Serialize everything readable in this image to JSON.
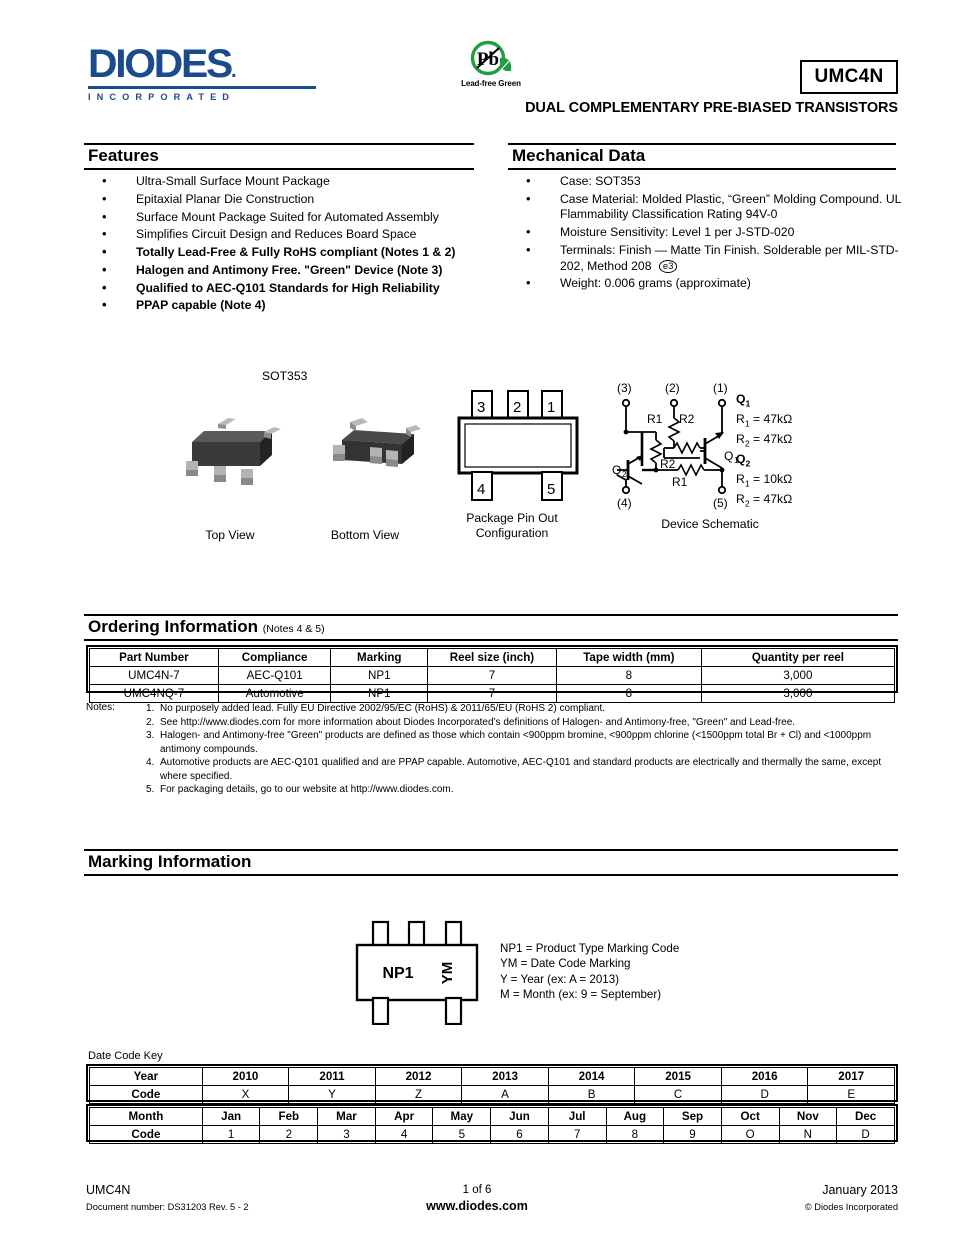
{
  "header": {
    "logo_main": "DIODES",
    "logo_sub": "INCORPORATED",
    "pb_symbol": "Pb",
    "pb_caption": "Lead-free Green",
    "part_number": "UMC4N",
    "subtitle": "DUAL COMPLEMENTARY PRE-BIASED TRANSISTORS"
  },
  "features": {
    "title": "Features",
    "items": [
      {
        "text": "Ultra-Small Surface Mount Package",
        "bold": false
      },
      {
        "text": "Epitaxial Planar Die Construction",
        "bold": false
      },
      {
        "text": "Surface Mount Package Suited for Automated Assembly",
        "bold": false
      },
      {
        "text": "Simplifies Circuit Design and Reduces Board Space",
        "bold": false
      },
      {
        "text": "Totally Lead-Free & Fully RoHS compliant (Notes 1 & 2)",
        "bold": true
      },
      {
        "text": "Halogen and Antimony Free. \"Green\" Device (Note 3)",
        "bold": true
      },
      {
        "text": "Qualified to AEC-Q101 Standards for High Reliability",
        "bold": true
      },
      {
        "text": "PPAP capable (Note 4)",
        "bold": true
      }
    ]
  },
  "mechanical": {
    "title": "Mechanical Data",
    "items": [
      "Case: SOT353",
      "Case Material: Molded Plastic, “Green” Molding Compound. UL Flammability  Classification Rating 94V-0",
      "Moisture Sensitivity:  Level 1 per J-STD-020",
      "Terminals: Finish — Matte Tin Finish. Solderable per MIL-STD-202, Method 208",
      "Weight: 0.006 grams (approximate)"
    ],
    "e3_symbol": "e3"
  },
  "package": {
    "sot_label": "SOT353",
    "top_view_label": "Top View",
    "bottom_view_label": "Bottom View",
    "pinout_caption_line1": "Package Pin Out",
    "pinout_caption_line2": "Configuration",
    "pinout_top_pins": [
      "3",
      "2",
      "1"
    ],
    "pinout_bottom_pins": [
      "4",
      "5"
    ]
  },
  "schematic": {
    "caption": "Device Schematic",
    "terminals": {
      "t3": "(3)",
      "t2": "(2)",
      "t1": "(1)",
      "t4": "(4)",
      "t5": "(5)"
    },
    "labels": {
      "q1": "Q",
      "q1sub": "1",
      "q2": "Q",
      "q2sub": "2",
      "r1": "R1",
      "r2": "R2"
    },
    "values": [
      {
        "head": "Q",
        "head_sub": "1"
      },
      {
        "name": "R",
        "name_sub": "1",
        "value": "= 47kΩ"
      },
      {
        "name": "R",
        "name_sub": "2",
        "value": "= 47kΩ"
      },
      {
        "head": "Q",
        "head_sub": "2"
      },
      {
        "name": "R",
        "name_sub": "1",
        "value": "= 10kΩ"
      },
      {
        "name": "R",
        "name_sub": "2",
        "value": "= 47kΩ"
      }
    ]
  },
  "ordering": {
    "title": "Ordering Information",
    "title_note": "(Notes 4 & 5)",
    "columns": [
      "Part Number",
      "Compliance",
      "Marking",
      "Reel size (inch)",
      "Tape width (mm)",
      "Quantity per reel"
    ],
    "rows": [
      [
        "UMC4N-7",
        "AEC-Q101",
        "NP1",
        "7",
        "8",
        "3,000"
      ],
      [
        "UMC4NQ-7",
        "Automotive",
        "NP1",
        "7",
        "8",
        "3,000"
      ]
    ]
  },
  "notes": {
    "label": "Notes:",
    "items": [
      {
        "num": "1.",
        "text": "No purposely added lead. Fully EU Directive 2002/95/EC (RoHS) & 2011/65/EU (RoHS 2) compliant."
      },
      {
        "num": "2.",
        "text": "See http://www.diodes.com for more information about Diodes Incorporated’s definitions of Halogen- and Antimony-free, \"Green\" and Lead-free."
      },
      {
        "num": "3.",
        "text": "Halogen- and Antimony-free \"Green\" products are defined as those which contain <900ppm bromine, <900ppm chlorine (<1500ppm total Br + Cl) and <1000ppm antimony compounds."
      },
      {
        "num": "4.",
        "text": "Automotive products are AEC-Q101 qualified and are PPAP capable.  Automotive, AEC-Q101 and standard products are electrically and thermally the same, except where specified."
      },
      {
        "num": "5.",
        "text": "For packaging details, go to our website at http://www.diodes.com."
      }
    ]
  },
  "marking": {
    "title": "Marking Information",
    "body_code": "NP1",
    "date_code": "YM",
    "legend": [
      "NP1 = Product Type Marking Code",
      "YM = Date Code Marking",
      "Y = Year (ex: A = 2013)",
      "M = Month (ex: 9 = September)"
    ]
  },
  "date_code_key": {
    "label": "Date Code Key",
    "year_row_header": "Year",
    "year_code_header": "Code",
    "years": [
      "2010",
      "2011",
      "2012",
      "2013",
      "2014",
      "2015",
      "2016",
      "2017"
    ],
    "year_codes": [
      "X",
      "Y",
      "Z",
      "A",
      "B",
      "C",
      "D",
      "E"
    ],
    "month_row_header": "Month",
    "month_code_header": "Code",
    "months": [
      "Jan",
      "Feb",
      "Mar",
      "Apr",
      "May",
      "Jun",
      "Jul",
      "Aug",
      "Sep",
      "Oct",
      "Nov",
      "Dec"
    ],
    "month_codes": [
      "1",
      "2",
      "3",
      "4",
      "5",
      "6",
      "7",
      "8",
      "9",
      "O",
      "N",
      "D"
    ]
  },
  "footer": {
    "part": "UMC4N",
    "doc_number": "Document number: DS31203 Rev. 5 - 2",
    "page": "1 of 6",
    "website": "www.diodes.com",
    "date": "January 2013",
    "copyright": "© Diodes Incorporated"
  },
  "colors": {
    "brand_blue": "#1a4b8c",
    "green": "#1e9e3e",
    "package_dark": "#2b2b2b"
  }
}
